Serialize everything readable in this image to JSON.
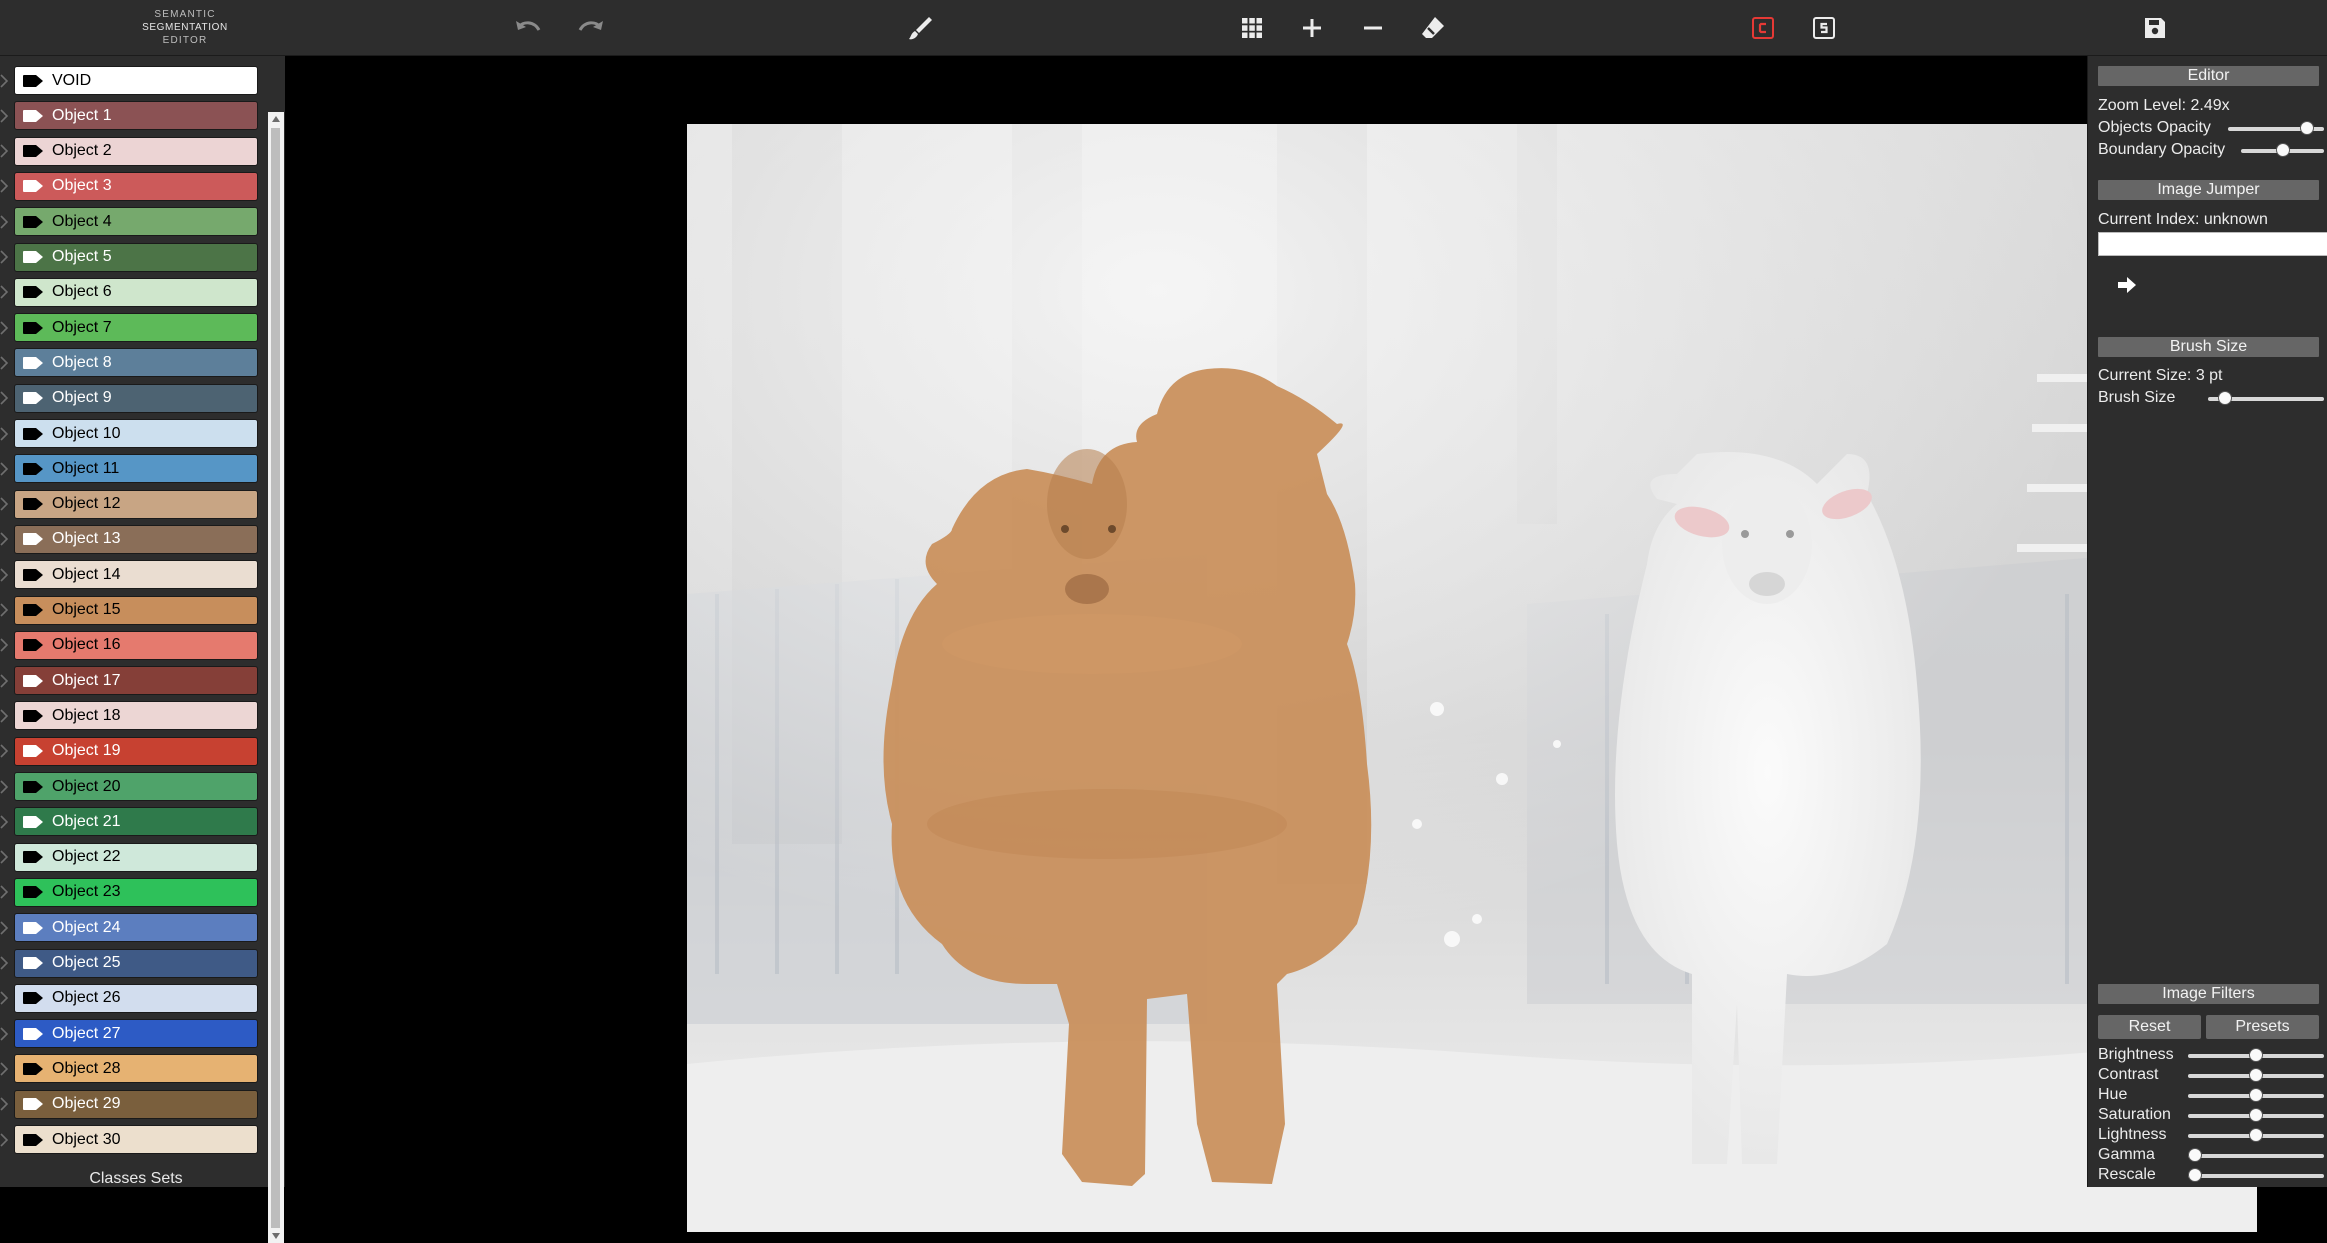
{
  "app": {
    "logo": [
      "SEMANTIC",
      "SEGMENTATION",
      "EDITOR"
    ]
  },
  "toolbar": {
    "icons": [
      "undo-icon",
      "redo-icon",
      "brush-icon",
      "grid-icon",
      "plus-icon",
      "minus-icon",
      "eraser-icon",
      "c-mode-icon",
      "s-mode-icon",
      "save-icon"
    ],
    "c_color": "#e53935"
  },
  "classes": [
    {
      "label": "VOID",
      "color": "#ffffff",
      "text": "#000000",
      "tag": "#000000"
    },
    {
      "label": "Object 1",
      "color": "#8b5254",
      "text": "#ffffff",
      "tag": "#ffffff"
    },
    {
      "label": "Object 2",
      "color": "#ecd4d4",
      "text": "#000000",
      "tag": "#000000"
    },
    {
      "label": "Object 3",
      "color": "#cc5a5a",
      "text": "#ffffff",
      "tag": "#ffffff"
    },
    {
      "label": "Object 4",
      "color": "#76a96d",
      "text": "#000000",
      "tag": "#000000"
    },
    {
      "label": "Object 5",
      "color": "#4c7447",
      "text": "#ffffff",
      "tag": "#ffffff"
    },
    {
      "label": "Object 6",
      "color": "#cfe6cc",
      "text": "#000000",
      "tag": "#000000"
    },
    {
      "label": "Object 7",
      "color": "#5dba59",
      "text": "#000000",
      "tag": "#000000"
    },
    {
      "label": "Object 8",
      "color": "#5d7f9a",
      "text": "#ffffff",
      "tag": "#ffffff"
    },
    {
      "label": "Object 9",
      "color": "#4d6372",
      "text": "#ffffff",
      "tag": "#ffffff"
    },
    {
      "label": "Object 10",
      "color": "#ccdfee",
      "text": "#000000",
      "tag": "#000000"
    },
    {
      "label": "Object 11",
      "color": "#5696c6",
      "text": "#000000",
      "tag": "#000000"
    },
    {
      "label": "Object 12",
      "color": "#c8a584",
      "text": "#000000",
      "tag": "#000000"
    },
    {
      "label": "Object 13",
      "color": "#8a6e58",
      "text": "#ffffff",
      "tag": "#ffffff"
    },
    {
      "label": "Object 14",
      "color": "#eaddd1",
      "text": "#000000",
      "tag": "#000000"
    },
    {
      "label": "Object 15",
      "color": "#c78e5c",
      "text": "#000000",
      "tag": "#000000"
    },
    {
      "label": "Object 16",
      "color": "#e57a6e",
      "text": "#000000",
      "tag": "#000000"
    },
    {
      "label": "Object 17",
      "color": "#853f38",
      "text": "#ffffff",
      "tag": "#ffffff"
    },
    {
      "label": "Object 18",
      "color": "#ecd6d4",
      "text": "#000000",
      "tag": "#000000"
    },
    {
      "label": "Object 19",
      "color": "#c74131",
      "text": "#ffffff",
      "tag": "#ffffff"
    },
    {
      "label": "Object 20",
      "color": "#4fa36a",
      "text": "#000000",
      "tag": "#000000"
    },
    {
      "label": "Object 21",
      "color": "#2f7a4b",
      "text": "#ffffff",
      "tag": "#ffffff"
    },
    {
      "label": "Object 22",
      "color": "#cfe8da",
      "text": "#000000",
      "tag": "#000000"
    },
    {
      "label": "Object 23",
      "color": "#2ec15a",
      "text": "#000000",
      "tag": "#000000"
    },
    {
      "label": "Object 24",
      "color": "#5c7ebf",
      "text": "#ffffff",
      "tag": "#ffffff"
    },
    {
      "label": "Object 25",
      "color": "#3f5a86",
      "text": "#ffffff",
      "tag": "#ffffff"
    },
    {
      "label": "Object 26",
      "color": "#d2ddee",
      "text": "#000000",
      "tag": "#000000"
    },
    {
      "label": "Object 27",
      "color": "#2d5bc5",
      "text": "#ffffff",
      "tag": "#ffffff"
    },
    {
      "label": "Object 28",
      "color": "#e6b272",
      "text": "#000000",
      "tag": "#000000"
    },
    {
      "label": "Object 29",
      "color": "#7a5f3d",
      "text": "#ffffff",
      "tag": "#ffffff"
    },
    {
      "label": "Object 30",
      "color": "#ecdfcd",
      "text": "#000000",
      "tag": "#000000"
    }
  ],
  "classes_sets_label": "Classes Sets",
  "editor": {
    "title": "Editor",
    "zoom": "Zoom Level: 2.49x",
    "objects_opacity": "Objects Opacity",
    "boundary_opacity": "Boundary Opacity",
    "objects_opacity_value": 0.88,
    "boundary_opacity_value": 0.5
  },
  "jumper": {
    "title": "Image Jumper",
    "current_index": "Current Index: unknown",
    "index_value": ""
  },
  "brush": {
    "title": "Brush Size",
    "current": "Current Size: 3 pt",
    "label": "Brush Size",
    "value": 0.1
  },
  "filters": {
    "title": "Image Filters",
    "reset": "Reset",
    "presets": "Presets",
    "items": [
      {
        "label": "Brightness",
        "value": 0.5
      },
      {
        "label": "Contrast",
        "value": 0.5
      },
      {
        "label": "Hue",
        "value": 0.5
      },
      {
        "label": "Saturation",
        "value": 0.5
      },
      {
        "label": "Lightness",
        "value": 0.5
      },
      {
        "label": "Gamma",
        "value": 0.0
      },
      {
        "label": "Rescale",
        "value": 0.0
      }
    ]
  },
  "segmentation": {
    "label_color": "#c78e5c"
  }
}
